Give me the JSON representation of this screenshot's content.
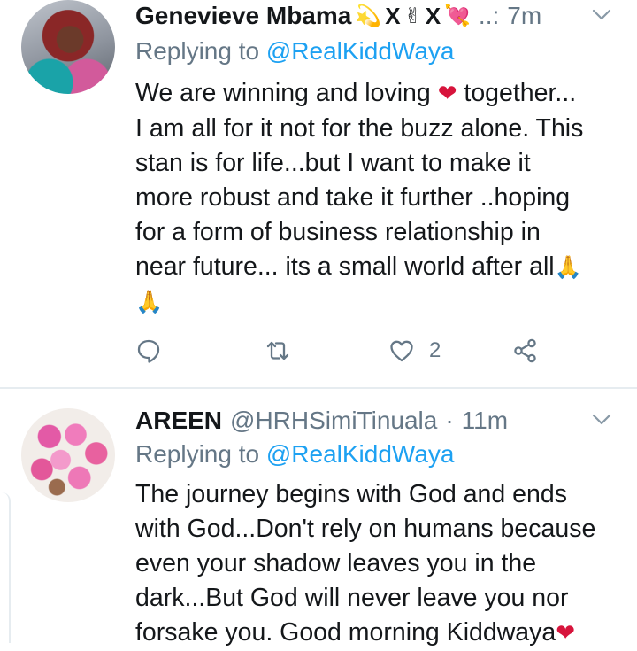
{
  "tweets": [
    {
      "name": "Genevieve Mbama",
      "name_suffix_emoji": [
        "💫",
        "X",
        "✌",
        "X",
        "💘"
      ],
      "handle": "..:",
      "separator": "",
      "time": "7m",
      "replying_label": "Replying to",
      "replying_to": "@RealKiddWaya",
      "body_lines": [
        "We are winning and loving",
        "together...",
        "I am all for it not for the buzz alone. This",
        "stan is for life...but I want to make it",
        "more robust and take it further ..hoping",
        "for a form of business relationship in",
        "near future... its a small world after all"
      ],
      "body_emoji": {
        "heart": "❤",
        "pray": "🙏"
      },
      "actions": {
        "reply_count": "",
        "retweet_count": "",
        "like_count": "2"
      }
    },
    {
      "name": "AREEN",
      "handle": "@HRHSimiTinuala",
      "separator": "·",
      "time": "11m",
      "replying_label": "Replying to",
      "replying_to": "@RealKiddWaya",
      "body_lines": [
        "The journey begins with God and ends",
        "with God...Don't rely on humans because",
        "even your shadow leaves you in the",
        "dark...But God will never leave you nor",
        "forsake you. Good morning Kiddwaya"
      ],
      "body_emoji": {
        "heart": "❤"
      }
    }
  ],
  "colors": {
    "text": "#14171a",
    "secondary": "#657786",
    "link": "#1da1f2",
    "heart": "#d7143c",
    "divider": "#e6ecf0"
  },
  "icons": [
    "reply-icon",
    "retweet-icon",
    "like-icon",
    "share-icon",
    "chevron-down-icon"
  ]
}
